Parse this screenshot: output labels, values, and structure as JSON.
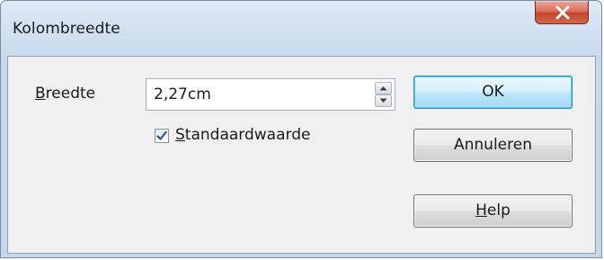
{
  "window": {
    "title": "Kolombreedte"
  },
  "width_field": {
    "label_access_key": "B",
    "label_rest": "reedte",
    "value": "2,27cm"
  },
  "default_checkbox": {
    "checked": true,
    "label_access_key": "S",
    "label_rest": "tandaardwaarde"
  },
  "buttons": {
    "ok": "OK",
    "cancel": "Annuleren",
    "help_access_key": "H",
    "help_rest": "elp"
  },
  "colors": {
    "close_button": "#c4432a",
    "default_button_border": "#3c7fb1",
    "checkmark": "#2b4f8c"
  }
}
